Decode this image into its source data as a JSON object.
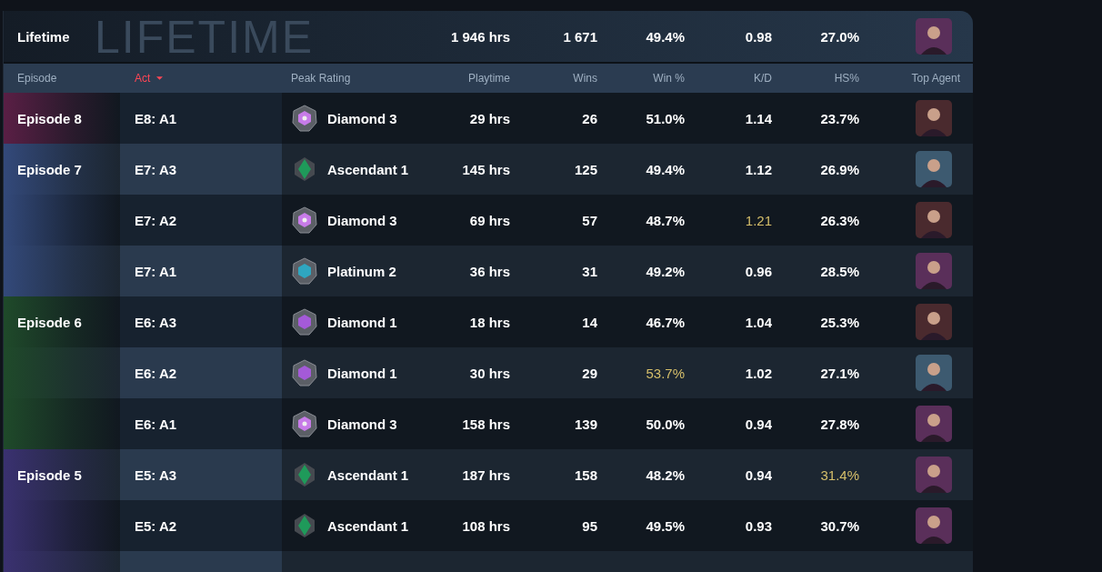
{
  "lifetime": {
    "watermark": "LIFETIME",
    "label": "Lifetime",
    "playtime": "1 946 hrs",
    "wins": "1 671",
    "win_pct": "49.4%",
    "kd": "0.98",
    "hs": "27.0%",
    "agent": {
      "color": "#5a2f5a"
    }
  },
  "columns": [
    {
      "label": "Episode",
      "sorted": false
    },
    {
      "label": "Act",
      "sorted": true
    },
    {
      "label": "Peak Rating",
      "sorted": false
    },
    {
      "label": "Playtime",
      "sorted": false
    },
    {
      "label": "Wins",
      "sorted": false
    },
    {
      "label": "Win %",
      "sorted": false
    },
    {
      "label": "K/D",
      "sorted": false
    },
    {
      "label": "HS%",
      "sorted": false
    },
    {
      "label": "Top Agent",
      "sorted": false
    }
  ],
  "episodes": [
    {
      "name": "Episode 8",
      "color": "#5a1f45",
      "acts": [
        {
          "act": "E8: A1",
          "kind": "diamond",
          "rank": "Diamond 3",
          "playtime": "29 hrs",
          "wins": "26",
          "win_pct": {
            "text": "51.0%",
            "best": false
          },
          "kd": {
            "text": "1.14",
            "best": false
          },
          "hs": {
            "text": "23.7%",
            "best": false
          },
          "agent": {
            "color": "#4a2a2e"
          }
        }
      ]
    },
    {
      "name": "Episode 7",
      "color": "#33497a",
      "acts": [
        {
          "act": "E7: A3",
          "kind": "ascendant",
          "rank": "Ascendant 1",
          "playtime": "145 hrs",
          "wins": "125",
          "win_pct": {
            "text": "49.4%",
            "best": false
          },
          "kd": {
            "text": "1.12",
            "best": false
          },
          "hs": {
            "text": "26.9%",
            "best": false
          },
          "agent": {
            "color": "#3d5a70"
          }
        },
        {
          "act": "E7: A2",
          "kind": "diamond",
          "rank": "Diamond 3",
          "playtime": "69 hrs",
          "wins": "57",
          "win_pct": {
            "text": "48.7%",
            "best": false
          },
          "kd": {
            "text": "1.21",
            "best": true
          },
          "hs": {
            "text": "26.3%",
            "best": false
          },
          "agent": {
            "color": "#4a2a2e"
          }
        },
        {
          "act": "E7: A1",
          "kind": "platinum",
          "rank": "Platinum 2",
          "playtime": "36 hrs",
          "wins": "31",
          "win_pct": {
            "text": "49.2%",
            "best": false
          },
          "kd": {
            "text": "0.96",
            "best": false
          },
          "hs": {
            "text": "28.5%",
            "best": false
          },
          "agent": {
            "color": "#5a2f5a"
          }
        }
      ]
    },
    {
      "name": "Episode 6",
      "color": "#1f4a2a",
      "acts": [
        {
          "act": "E6: A3",
          "kind": "diamond_low",
          "rank": "Diamond 1",
          "playtime": "18 hrs",
          "wins": "14",
          "win_pct": {
            "text": "46.7%",
            "best": false
          },
          "kd": {
            "text": "1.04",
            "best": false
          },
          "hs": {
            "text": "25.3%",
            "best": false
          },
          "agent": {
            "color": "#4a2a2e"
          }
        },
        {
          "act": "E6: A2",
          "kind": "diamond_low",
          "rank": "Diamond 1",
          "playtime": "30 hrs",
          "wins": "29",
          "win_pct": {
            "text": "53.7%",
            "best": true
          },
          "kd": {
            "text": "1.02",
            "best": false
          },
          "hs": {
            "text": "27.1%",
            "best": false
          },
          "agent": {
            "color": "#3d5a70"
          }
        },
        {
          "act": "E6: A1",
          "kind": "diamond",
          "rank": "Diamond 3",
          "playtime": "158 hrs",
          "wins": "139",
          "win_pct": {
            "text": "50.0%",
            "best": false
          },
          "kd": {
            "text": "0.94",
            "best": false
          },
          "hs": {
            "text": "27.8%",
            "best": false
          },
          "agent": {
            "color": "#5a2f5a"
          }
        }
      ]
    },
    {
      "name": "Episode 5",
      "color": "#3a3170",
      "acts": [
        {
          "act": "E5: A3",
          "kind": "ascendant",
          "rank": "Ascendant 1",
          "playtime": "187 hrs",
          "wins": "158",
          "win_pct": {
            "text": "48.2%",
            "best": false
          },
          "kd": {
            "text": "0.94",
            "best": false
          },
          "hs": {
            "text": "31.4%",
            "best": true
          },
          "agent": {
            "color": "#5a2f5a"
          }
        },
        {
          "act": "E5: A2",
          "kind": "ascendant",
          "rank": "Ascendant 1",
          "playtime": "108 hrs",
          "wins": "95",
          "win_pct": {
            "text": "49.5%",
            "best": false
          },
          "kd": {
            "text": "0.93",
            "best": false
          },
          "hs": {
            "text": "30.7%",
            "best": false
          },
          "agent": {
            "color": "#5a2f5a"
          }
        }
      ]
    }
  ]
}
